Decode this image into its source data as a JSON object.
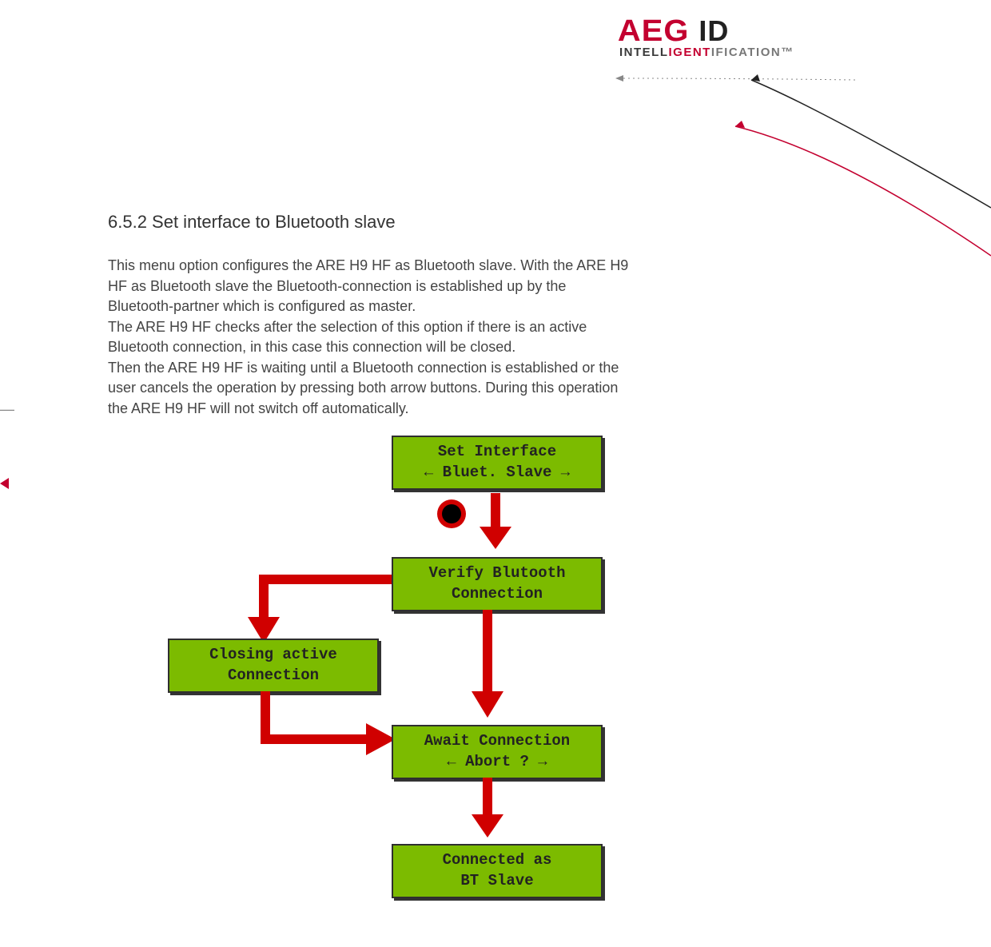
{
  "logo": {
    "aeg": "AEG",
    "id": "ID",
    "tag_a": "INTELL",
    "tag_b": "IGENT",
    "tag_c": "IFICATION™"
  },
  "heading": "6.5.2  Set interface to Bluetooth slave",
  "paragraph": "This menu option configures the ARE H9 HF as Bluetooth slave. With the ARE H9 HF as Bluetooth slave the Bluetooth-connection is established up by the Bluetooth-partner which is configured as master.\nThe ARE H9 HF checks after the selection of this option if there is an active Bluetooth connection, in this case this connection will be closed.\nThen the ARE H9 HF is waiting until a Bluetooth connection is established or the user cancels the operation by pressing both arrow buttons. During this operation the ARE H9 HF will not switch off automatically.",
  "leftStub": "—",
  "diagram": {
    "set": {
      "line1": "Set Interface",
      "line2": "← Bluet. Slave →"
    },
    "verify": {
      "line1": "Verify Blutooth",
      "line2": "Connection"
    },
    "close": {
      "line1": "Closing active",
      "line2": "Connection"
    },
    "await": {
      "line1": "Await Connection",
      "line2": "←    Abort ?   →"
    },
    "connected": {
      "line1": "Connected as",
      "line2": "BT Slave"
    }
  }
}
